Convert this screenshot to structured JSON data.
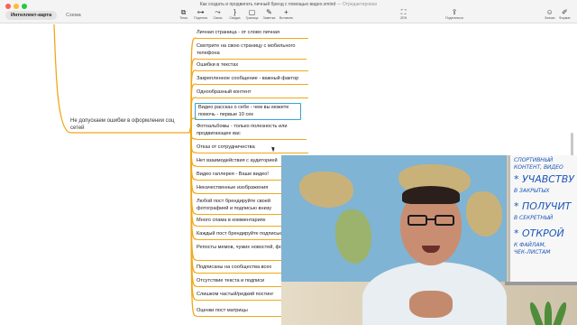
{
  "window": {
    "title": "Как создать и продвигать личный бренд с помощью видео.xmind",
    "edited": "— Отредактирован"
  },
  "tabs": [
    {
      "label": "Интеллект-карта",
      "active": true
    },
    {
      "label": "Схема",
      "active": false
    }
  ],
  "toolbar": [
    {
      "icon": "topic-icon",
      "glyph": "⧉",
      "label": "Тема"
    },
    {
      "icon": "subtopic-icon",
      "glyph": "⊶",
      "label": "Подтема"
    },
    {
      "icon": "relationship-icon",
      "glyph": "⤳",
      "label": "Связь"
    },
    {
      "icon": "summary-icon",
      "glyph": "}",
      "label": "Сводка"
    },
    {
      "icon": "boundary-icon",
      "glyph": "▢",
      "label": "Граница"
    },
    {
      "icon": "note-icon",
      "glyph": "✎",
      "label": "Заметка"
    },
    {
      "icon": "insert-icon",
      "glyph": "+",
      "label": "Вставить"
    }
  ],
  "toolbar_right": {
    "zen": {
      "glyph": "⛶",
      "label": "ZEN"
    },
    "share": {
      "glyph": "⇪",
      "label": "Поделиться"
    },
    "icons": {
      "glyph": "☺",
      "label": "Значки"
    },
    "format": {
      "glyph": "✐",
      "label": "Формат"
    }
  },
  "mindmap": {
    "root": "Не допускаем ошибки в оформлении соц сетей",
    "children": [
      "Личная страница - от слово личная",
      "Смотрите на свою страницу с мобильного телефона",
      "Ошибки в текстах",
      "Закрепленное сообщение - важный фактор",
      "Однообразный контент",
      "Видео рассказ о себе - чем вы можете помочь - первые 10 сек",
      "Фотоальбомы - только полезность или продвигающее вас",
      "Отказ от сотрудничества",
      "Нет взаимодействия с аудиторией",
      "Видео галлерея - Ваше видео!",
      "Некачественные изображения",
      "Любой пост брендируйте своей фотографией и подписью внизу",
      "Много спама в комментариях",
      "Каждый пост брендируйте подписью",
      "Репосты мемов, чужих новостей, фото - зло",
      "Подписаны на сообщества всех",
      "Отсутствие текста и подписи",
      "Слишком частый/редкий постинг",
      "Оценки пост матрицы"
    ],
    "selected_index": 5
  },
  "whiteboard": {
    "lines": [
      "СПОРТИВНЫЙ",
      "КОНТЕНТ, ВИДЕО",
      "* УЧАВСТВУ",
      "В ЗАКРЫТЫХ",
      "* ПОЛУЧИТ",
      "В СЕКРЕТНЫЙ",
      "* ОТКРОЙ",
      "К ФАЙЛАМ,",
      "ЧЕК-ЛИСТАМ"
    ]
  },
  "colors": {
    "branch": "#f0a818",
    "selection": "#3ba0dc",
    "board_ink": "#1d56b8"
  }
}
